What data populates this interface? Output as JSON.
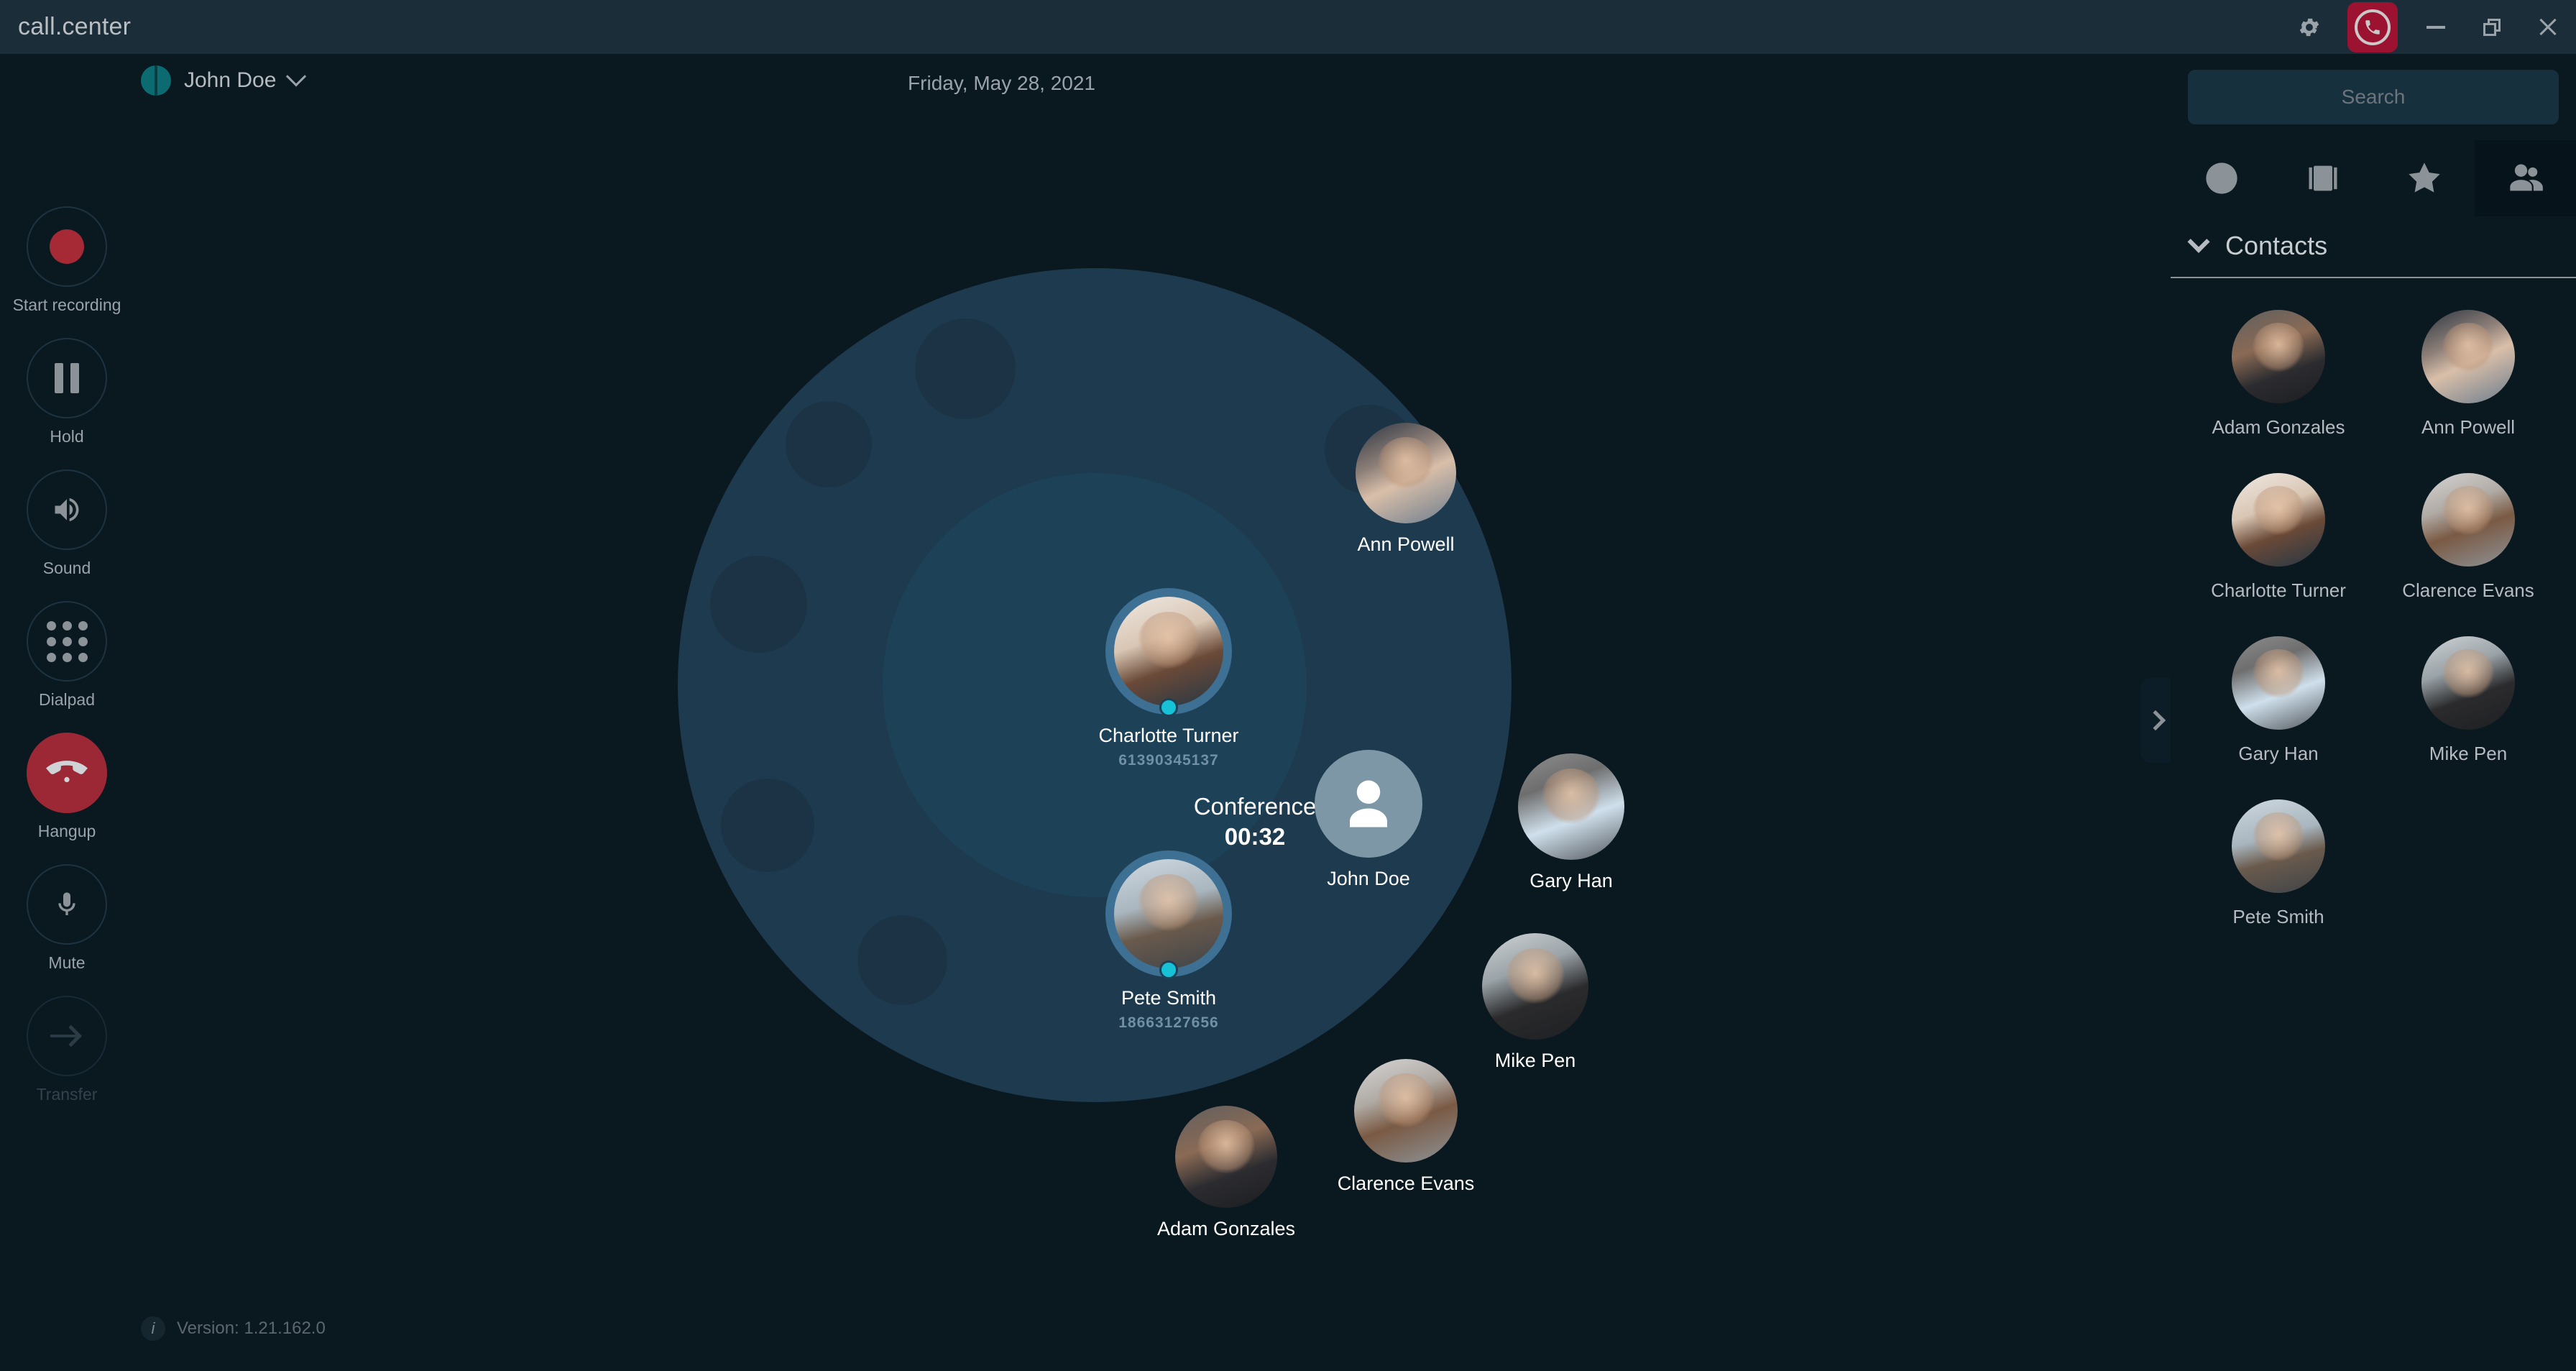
{
  "titlebar": {
    "app_title": "call.center",
    "gear_icon": "gear-icon",
    "app_icon": "phone-app-icon",
    "minimize_icon": "minimize-icon",
    "restore_icon": "restore-icon",
    "close_icon": "close-icon",
    "accent_red": "#9c1331"
  },
  "subheader": {
    "user_name": "John Doe",
    "user_status_color": "#0b6b70",
    "dropdown_icon": "chevron-down-icon",
    "date": "Friday, May 28, 2021"
  },
  "sidebar": {
    "items": [
      {
        "label": "Start recording",
        "icon": "record-icon",
        "state": "enabled"
      },
      {
        "label": "Hold",
        "icon": "pause-icon",
        "state": "enabled"
      },
      {
        "label": "Sound",
        "icon": "speaker-icon",
        "state": "enabled"
      },
      {
        "label": "Dialpad",
        "icon": "dialpad-icon",
        "state": "enabled"
      },
      {
        "label": "Hangup",
        "icon": "hangup-icon",
        "state": "active"
      },
      {
        "label": "Mute",
        "icon": "microphone-icon",
        "state": "enabled"
      },
      {
        "label": "Transfer",
        "icon": "arrow-right-icon",
        "state": "disabled"
      }
    ],
    "hangup_color": "#9c2836",
    "record_color": "#a52a36"
  },
  "footer": {
    "info_icon": "info-icon",
    "version_text": "Version: 1.21.162.0"
  },
  "conference": {
    "title": "Conference",
    "timer": "00:32",
    "status_dot_color": "#17c2d6",
    "outer_circle_color": "#1d3a4e",
    "inner_circle_color": "#1d4258",
    "participants": [
      {
        "name": "Ann Powell",
        "phone": "",
        "in_conference": false,
        "photo": "p-ann"
      },
      {
        "name": "Charlotte Turner",
        "phone": "61390345137",
        "in_conference": true,
        "photo": "p-charlot"
      },
      {
        "name": "John Doe",
        "phone": "",
        "in_conference": false,
        "photo": "placeholder"
      },
      {
        "name": "Gary Han",
        "phone": "",
        "in_conference": false,
        "photo": "p-gary"
      },
      {
        "name": "Pete Smith",
        "phone": "18663127656",
        "in_conference": true,
        "photo": "p-pete"
      },
      {
        "name": "Mike Pen",
        "phone": "",
        "in_conference": false,
        "photo": "p-mike"
      },
      {
        "name": "Clarence Evans",
        "phone": "",
        "in_conference": false,
        "photo": "p-clar"
      },
      {
        "name": "Adam Gonzales",
        "phone": "",
        "in_conference": false,
        "photo": "p-adam"
      }
    ],
    "collapse_icon": "chevron-right-icon"
  },
  "rightpanel": {
    "search_placeholder": "Search",
    "search_value": "",
    "tabs": [
      {
        "icon": "clock-icon",
        "name": "history",
        "active": false
      },
      {
        "icon": "briefcase-icon",
        "name": "voicemail",
        "active": false
      },
      {
        "icon": "star-icon",
        "name": "favorites",
        "active": false
      },
      {
        "icon": "people-icon",
        "name": "contacts",
        "active": true
      }
    ],
    "section_title": "Contacts",
    "section_chevron": "chevron-down-icon",
    "contacts": [
      {
        "name": "Adam Gonzales",
        "photo": "p-adam"
      },
      {
        "name": "Ann Powell",
        "photo": "p-ann"
      },
      {
        "name": "Charlotte Turner",
        "photo": "p-charlot"
      },
      {
        "name": "Clarence Evans",
        "photo": "p-clar"
      },
      {
        "name": "Gary Han",
        "photo": "p-gary"
      },
      {
        "name": "Mike Pen",
        "photo": "p-mike"
      },
      {
        "name": "Pete Smith",
        "photo": "p-pete"
      }
    ]
  }
}
